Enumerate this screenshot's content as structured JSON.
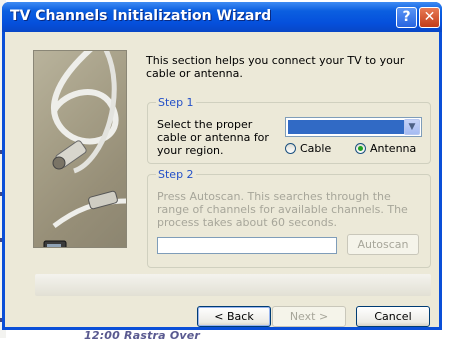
{
  "window": {
    "title": "TV Channels Initialization Wizard",
    "help_glyph": "?",
    "close_glyph": "✕"
  },
  "intro_text": "This section helps you connect your TV to your cable or antenna.",
  "step1": {
    "legend": "Step 1",
    "description": "Select the proper cable or antenna for your region.",
    "combo_value": "",
    "combo_arrow_glyph": "▼",
    "radio_cable": "Cable",
    "radio_antenna": "Antenna",
    "selected": "Antenna"
  },
  "step2": {
    "legend": "Step 2",
    "description": "Press Autoscan. This searches through the range of channels for available channels. The process takes about 60 seconds.",
    "autoscan_label": "Autoscan",
    "progress_value": 0
  },
  "buttons": {
    "back": "< Back",
    "next": "Next >",
    "cancel": "Cancel"
  },
  "background_fragment": "12:00 Rastra Over",
  "colors": {
    "title_bar": "#0550dc",
    "dialog_bg": "#ece9d8",
    "legend_text": "#2350c8",
    "disabled_text": "#a7a69a"
  },
  "icons": [
    "help-icon",
    "close-icon",
    "dropdown-arrow-icon",
    "tv-icon",
    "coaxial-cable-image"
  ]
}
